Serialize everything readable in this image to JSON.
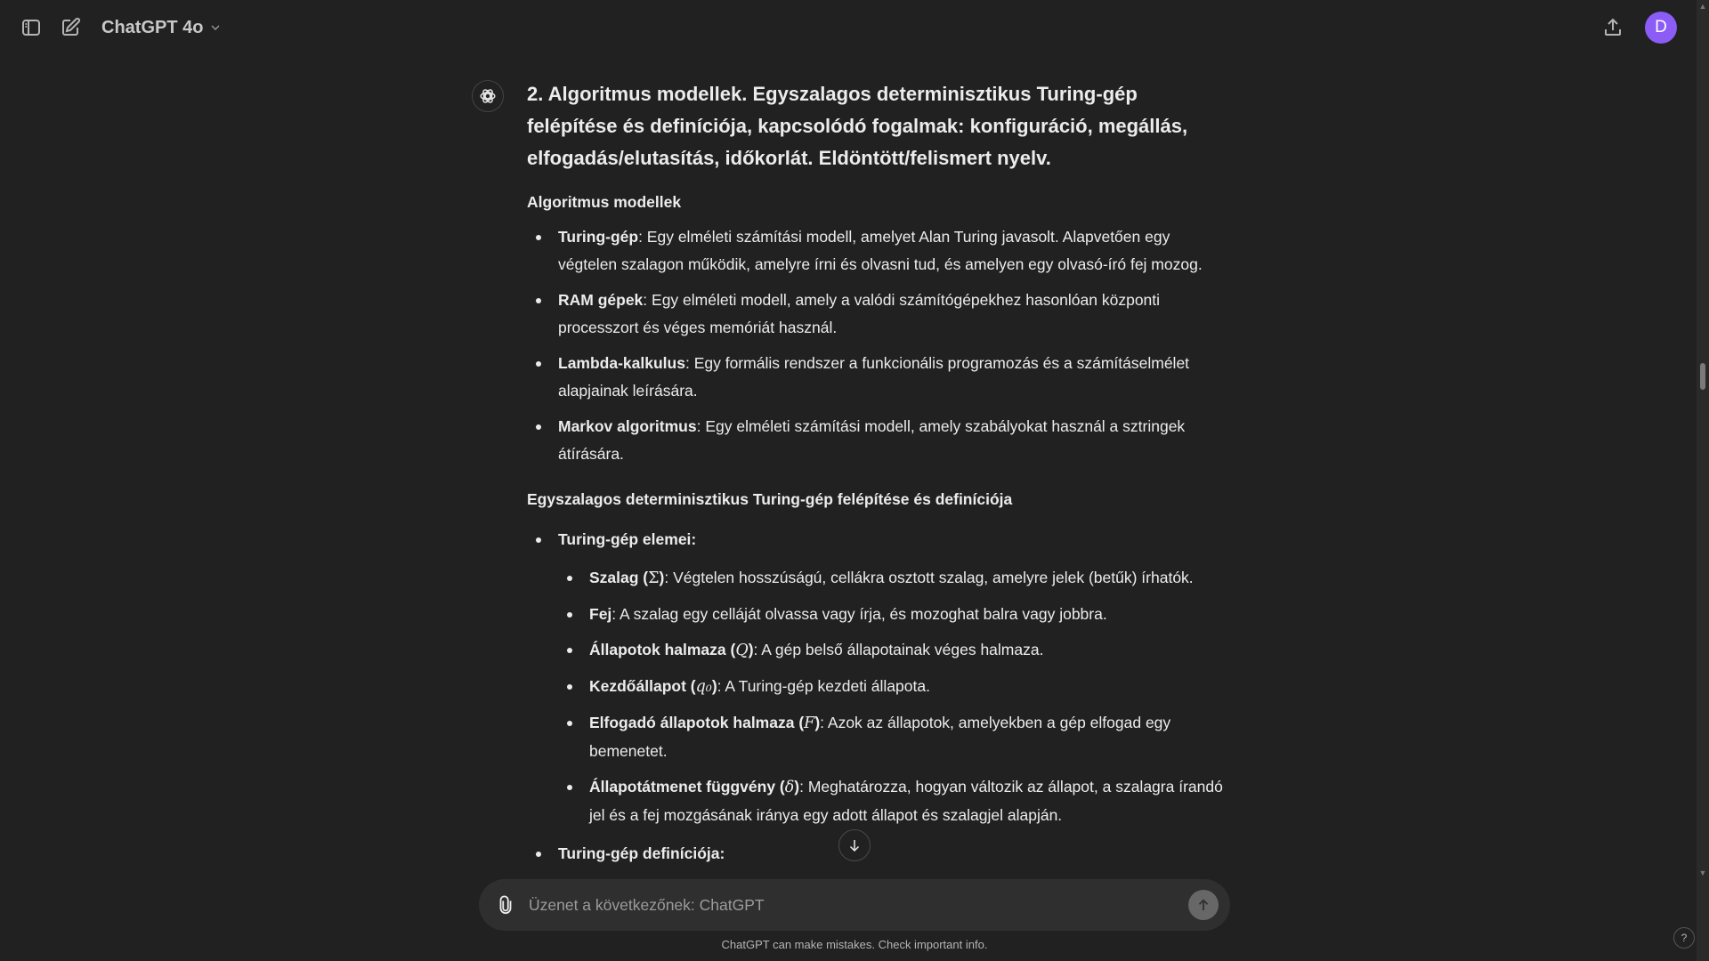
{
  "header": {
    "model_name": "ChatGPT 4o",
    "avatar_initial": "D",
    "icons": {
      "sidebar": "sidebar-toggle-icon",
      "new_chat": "new-chat-icon",
      "model_dropdown": "chevron-down-icon",
      "share": "share-icon"
    }
  },
  "message": {
    "heading": "2. Algoritmus modellek. Egyszalagos determinisztikus Turing-gép felépítése és definíciója, kapcsolódó fogalmak: konfiguráció, megállás, elfogadás/elutasítás, időkorlát. Eldöntött/felismert nyelv.",
    "section1": {
      "title": "Algoritmus modellek",
      "items": [
        {
          "term": "Turing-gép",
          "text": ": Egy elméleti számítási modell, amelyet Alan Turing javasolt. Alapvetően egy végtelen szalagon működik, amelyre írni és olvasni tud, és amelyen egy olvasó-író fej mozog."
        },
        {
          "term": "RAM gépek",
          "text": ": Egy elméleti modell, amely a valódi számítógépekhez hasonlóan központi processzort és véges memóriát használ."
        },
        {
          "term": "Lambda-kalkulus",
          "text": ": Egy formális rendszer a funkcionális programozás és a számításelmélet alapjainak leírására."
        },
        {
          "term": "Markov algoritmus",
          "text": ": Egy elméleti számítási modell, amely szabályokat használ a sztringek átírására."
        }
      ]
    },
    "section2": {
      "title": "Egyszalagos determinisztikus Turing-gép felépítése és definíciója",
      "elements_label": "Turing-gép elemei:",
      "elements": [
        {
          "term": "Szalag (",
          "symbol": "Σ",
          "term_end": ")",
          "text": ": Végtelen hosszúságú, cellákra osztott szalag, amelyre jelek (betűk) írhatók."
        },
        {
          "term": "Fej",
          "symbol": "",
          "term_end": "",
          "text": ": A szalag egy celláját olvassa vagy írja, és mozoghat balra vagy jobbra."
        },
        {
          "term": "Állapotok halmaza (",
          "symbol": "Q",
          "term_end": ")",
          "text": ": A gép belső állapotainak véges halmaza."
        },
        {
          "term": "Kezdőállapot (",
          "symbol": "q₀",
          "term_end": ")",
          "text": ": A Turing-gép kezdeti állapota."
        },
        {
          "term": "Elfogadó állapotok halmaza (",
          "symbol": "F",
          "term_end": ")",
          "text": ": Azok az állapotok, amelyekben a gép elfogad egy bemenetet."
        },
        {
          "term": "Állapotátmenet függvény (",
          "symbol": "δ",
          "term_end": ")",
          "text": ": Meghatározza, hogyan változik az állapot, a szalagra írandó jel és a fej mozgásának iránya egy adott állapot és szalagjel alapján."
        }
      ],
      "definition_label": "Turing-gép definíciója:"
    }
  },
  "composer": {
    "placeholder": "Üzenet a következőnek: ChatGPT",
    "value": ""
  },
  "footer": {
    "disclaimer": "ChatGPT can make mistakes. Check important info.",
    "help": "?"
  }
}
